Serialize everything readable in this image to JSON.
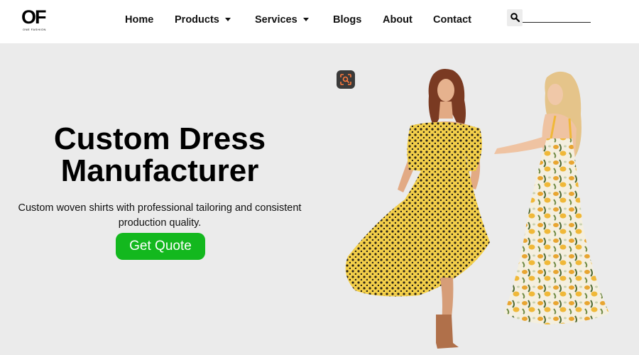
{
  "brand": {
    "logo_text": "OF",
    "logo_subtext": "ONE FASHION"
  },
  "nav": {
    "items": [
      {
        "label": "Home",
        "has_dropdown": false
      },
      {
        "label": "Products",
        "has_dropdown": true
      },
      {
        "label": "Services",
        "has_dropdown": true
      },
      {
        "label": "Blogs",
        "has_dropdown": false
      },
      {
        "label": "About",
        "has_dropdown": false
      },
      {
        "label": "Contact",
        "has_dropdown": false
      }
    ],
    "search": {
      "icon": "search-icon",
      "value": ""
    }
  },
  "hero": {
    "title_line1": "Custom Dress",
    "title_line2": "Manufacturer",
    "subtitle": "Custom woven shirts with professional tailoring and consistent production quality.",
    "cta_label": "Get Quote",
    "lens_icon": "visual-search-icon"
  },
  "colors": {
    "accent": "#13b81e",
    "hero_background": "#ebebeb",
    "header_background": "#ffffff",
    "text": "#000000"
  }
}
